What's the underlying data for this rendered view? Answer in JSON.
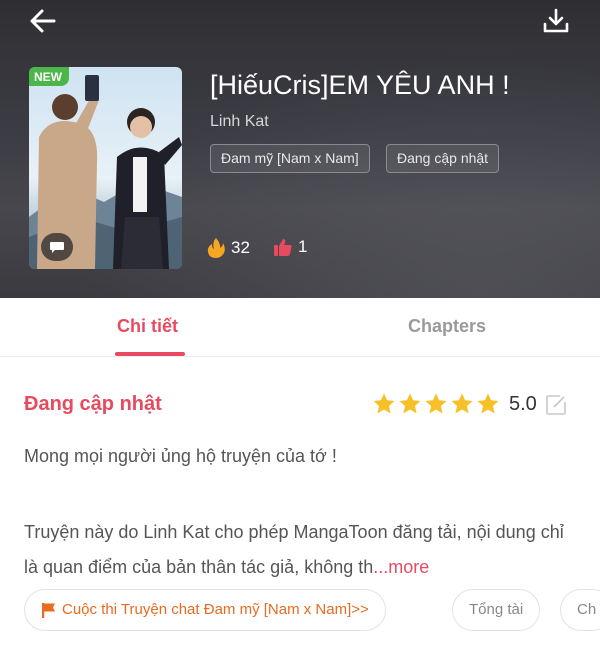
{
  "book": {
    "badge": "NEW",
    "title": "[HiếuCris]EM YÊU ANH !",
    "author": "Linh Kat",
    "tags": [
      "Đam mỹ [Nam x Nam]",
      "Đang cập nhật"
    ],
    "hot_count": "32",
    "like_count": "1"
  },
  "tabs": {
    "details": "Chi tiết",
    "chapters": "Chapters"
  },
  "detail": {
    "status": "Đang cập nhật",
    "stars": 5,
    "rating": "5.0",
    "description_line1": "Mong mọi người ủng hộ truyện của tớ !",
    "description_line2": "Truyện này do Linh Kat cho phép MangaToon đăng tải, nội dung chỉ là quan điểm của bản thân tác giả, không th",
    "more_label": "...more"
  },
  "chips": {
    "contest": "Cuộc thi Truyện chat Đam mỹ [Nam x Nam]>>",
    "president": "Tổng tài",
    "partial": "Ch"
  },
  "colors": {
    "accent": "#e84a5f",
    "new_badge": "#4cb64a",
    "star": "#f6c026",
    "contest": "#e96b1f"
  },
  "icons": {
    "back": "back-arrow-icon",
    "download": "download-icon",
    "chat": "chat-bubble-icon",
    "hot": "fire-icon",
    "like": "thumbs-up-icon",
    "edit": "edit-icon",
    "flag": "flag-icon"
  }
}
